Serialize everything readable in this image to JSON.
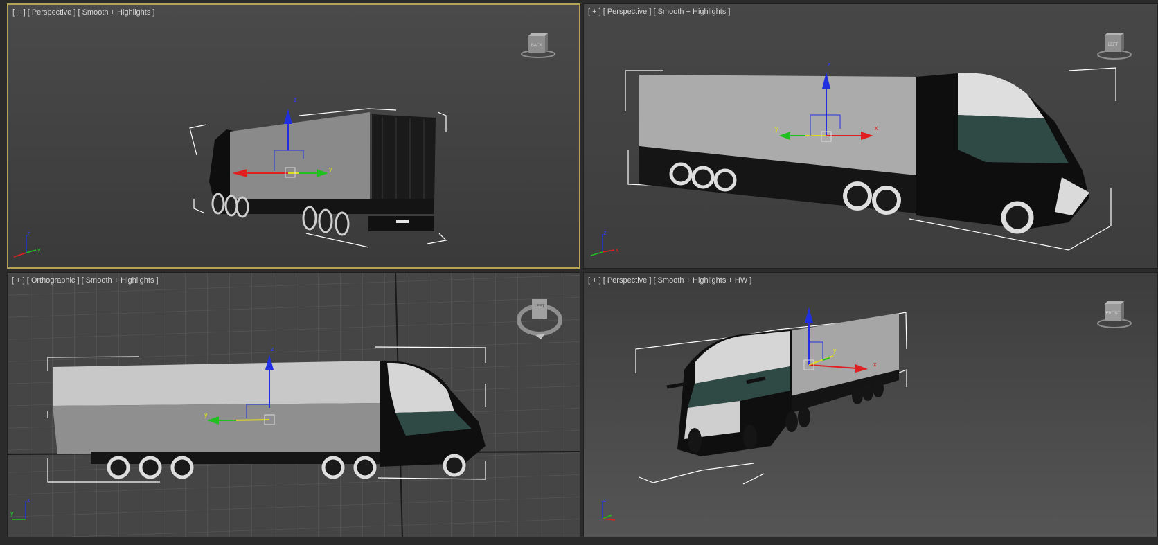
{
  "viewports": [
    {
      "id": "top-left",
      "label": {
        "plus": "[ + ]",
        "view": "[ Perspective ]",
        "shading": "[ Smooth + Highlights ]"
      },
      "active": true,
      "viewcube_text": "BACK"
    },
    {
      "id": "top-right",
      "label": {
        "plus": "[ + ]",
        "view": "[ Perspective ]",
        "shading": "[ Smooth + Highlights ]"
      },
      "active": false,
      "viewcube_text": "LEFT"
    },
    {
      "id": "bottom-left",
      "label": {
        "plus": "[ + ]",
        "view": "[ Orthographic ]",
        "shading": "[ Smooth + Highlights ]"
      },
      "active": false,
      "viewcube_text": "LEFT"
    },
    {
      "id": "bottom-right",
      "label": {
        "plus": "[ + ]",
        "view": "[ Perspective ]",
        "shading": "[ Smooth + Highlights + HW ]"
      },
      "active": false,
      "viewcube_text": "FRONT"
    }
  ],
  "axis_labels": {
    "x": "x",
    "y": "y",
    "z": "z"
  },
  "colors": {
    "active_border": "#b7a356",
    "axis_x": "#e02020",
    "axis_y": "#20c020",
    "axis_z": "#2030e0",
    "trailer_body": "#a9a9a9",
    "cab_dark": "#111111",
    "cab_light": "#d8d8d8",
    "glass": "#2f4a44",
    "bbox": "#ffffff"
  }
}
